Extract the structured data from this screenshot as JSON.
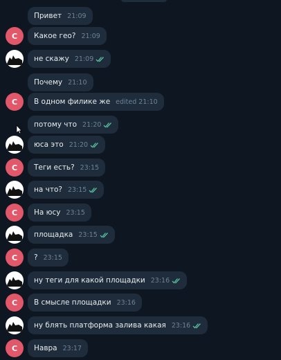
{
  "avatar_letter": "C",
  "messages": [
    {
      "sender": "c",
      "text": "Привет",
      "time": "21:09",
      "read": false,
      "avatar": false
    },
    {
      "sender": "c",
      "text": "Какое гео?",
      "time": "21:09",
      "read": false,
      "avatar": true
    },
    {
      "sender": "me",
      "text": "не скажу",
      "time": "21:09",
      "read": true,
      "avatar": true
    },
    {
      "sender": "c",
      "text": "Почему",
      "time": "21:10",
      "read": false,
      "avatar": false
    },
    {
      "sender": "c",
      "text": "В одном филике же",
      "time": "edited 21:10",
      "read": false,
      "avatar": true
    },
    {
      "sender": "me",
      "text": "потому что",
      "time": "21:20",
      "read": true,
      "avatar": false
    },
    {
      "sender": "me",
      "text": "юса это",
      "time": "21:20",
      "read": true,
      "avatar": true
    },
    {
      "sender": "c",
      "text": "Теги есть?",
      "time": "23:15",
      "read": false,
      "avatar": true
    },
    {
      "sender": "me",
      "text": "на что?",
      "time": "23:15",
      "read": true,
      "avatar": true
    },
    {
      "sender": "c",
      "text": "На юсу",
      "time": "23:15",
      "read": false,
      "avatar": true
    },
    {
      "sender": "me",
      "text": "площадка",
      "time": "23:15",
      "read": true,
      "avatar": true
    },
    {
      "sender": "c",
      "text": "?",
      "time": "23:15",
      "read": false,
      "avatar": true
    },
    {
      "sender": "me",
      "text": "ну теги для какой площадки",
      "time": "23:16",
      "read": true,
      "avatar": true
    },
    {
      "sender": "c",
      "text": "В смысле площадки",
      "time": "23:16",
      "read": false,
      "avatar": true
    },
    {
      "sender": "me",
      "text": "ну блять платформа залива какая",
      "time": "23:16",
      "read": true,
      "avatar": true
    },
    {
      "sender": "c",
      "text": "Навра",
      "time": "23:17",
      "read": false,
      "avatar": true
    }
  ]
}
